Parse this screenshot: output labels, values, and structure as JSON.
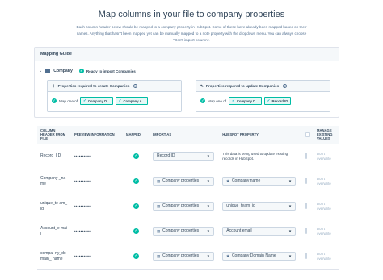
{
  "page": {
    "title": "Map columns in your file to company properties",
    "description": "Each column header below should be mapped to a company property in HubSpot. Some of these have already been mapped based on their names. Anything that hasn't been mapped yet can be manually mapped to a note property with the dropdown menu. You can always choose \"Don't import column\"."
  },
  "guide": {
    "title": "Mapping Guide",
    "object": "Company",
    "status": "Ready to import Companies",
    "create_box": {
      "title": "Properties required to create Companies",
      "map_label": "Map one of",
      "chips": [
        "Company D...",
        "Company n..."
      ]
    },
    "update_box": {
      "title": "Properties required to update Companies",
      "map_label": "Map one of",
      "chips": [
        "Company D...",
        "Record ID"
      ]
    }
  },
  "table": {
    "headers": {
      "column": "Column header from file",
      "preview": "Preview information",
      "mapped": "Mapped",
      "import_as": "Import as",
      "property": "HubSpot property",
      "manage": "Manage existing values"
    },
    "rows": [
      {
        "column": "Record_I D",
        "preview": "•••••••••••",
        "import_as": "Record ID",
        "property_note": "This data is being used to update existing records in HubSpot.",
        "overwrite": "Don't overwrite"
      },
      {
        "column": "Company _name",
        "preview": "•••••••••••",
        "import_as": "Company properties",
        "property": "Company name",
        "overwrite": "Don't overwrite"
      },
      {
        "column": "unique_te am_id",
        "preview": "•••••••••••",
        "import_as": "Company properties",
        "property": "unique_team_id",
        "overwrite": "Don't overwrite"
      },
      {
        "column": "Account_e mail",
        "preview": "•••••••••••",
        "import_as": "Company properties",
        "property": "Account email",
        "overwrite": "Don't overwrite"
      },
      {
        "column": "compa- ny_do- main_ name",
        "preview": "•••••••••••",
        "import_as": "Company properties",
        "property": "Company Domain Name",
        "overwrite": "Don't overwrite"
      }
    ]
  },
  "icons": {
    "check": "check-circle-icon",
    "caret": "caret-down-icon",
    "chevron": "chevron-down-icon",
    "building": "building-icon",
    "info": "info-icon",
    "property": "property-icon"
  },
  "colors": {
    "teal": "#00bda5",
    "text": "#33475b",
    "border": "#cbd6e2"
  }
}
